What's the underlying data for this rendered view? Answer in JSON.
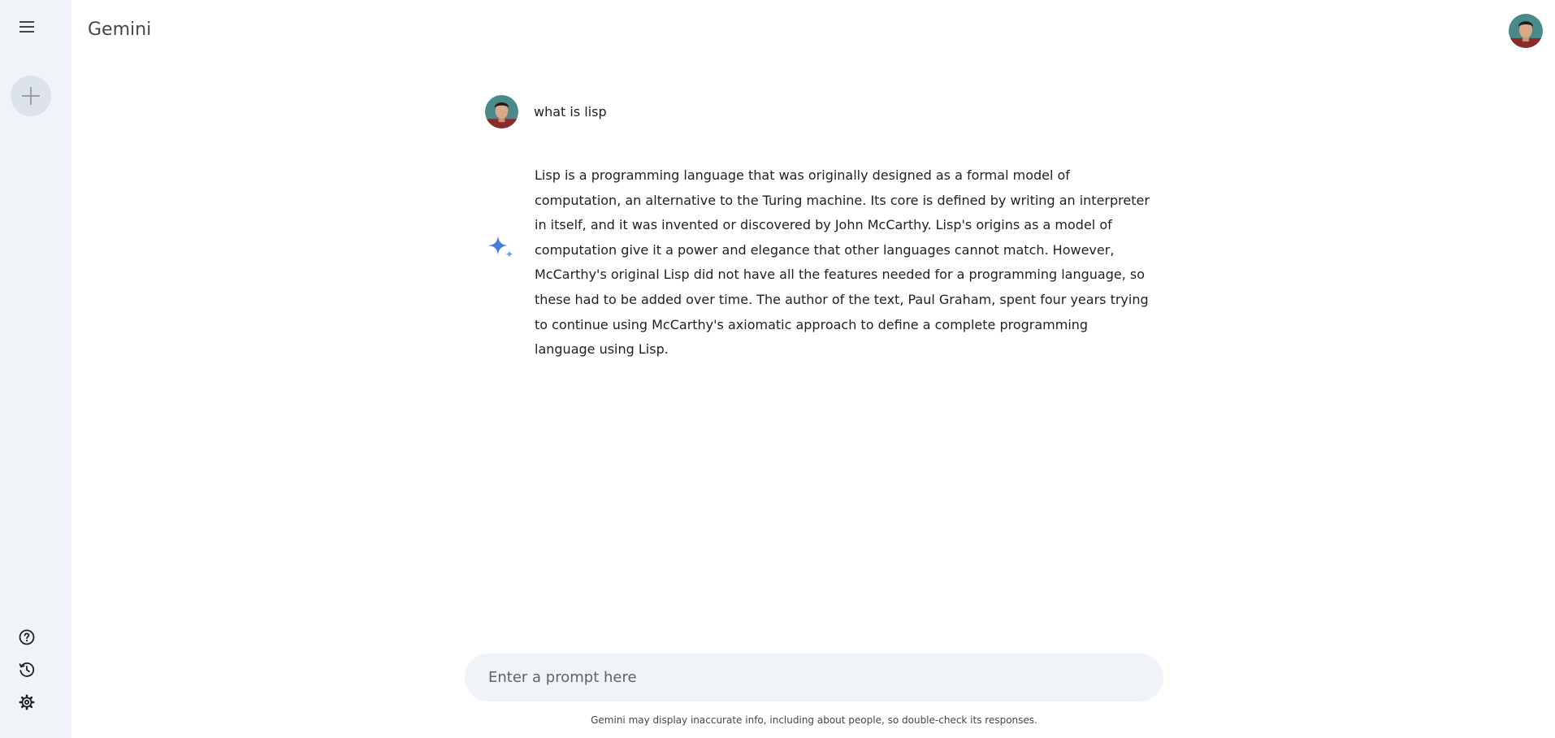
{
  "app": {
    "title": "Gemini"
  },
  "sidebar": {
    "menu_icon": "menu-icon",
    "new_chat_icon": "plus-icon",
    "bottom": [
      {
        "icon": "help-icon",
        "name": "help"
      },
      {
        "icon": "history-icon",
        "name": "activity"
      },
      {
        "icon": "gear-icon",
        "name": "settings"
      }
    ]
  },
  "conversation": {
    "user_query": "what is lisp",
    "response": "Lisp is a programming language that was originally designed as a formal model of computation, an alternative to the Turing machine. Its core is defined by writing an interpreter in itself, and it was invented or discovered by John McCarthy. Lisp's origins as a model of computation give it a power and elegance that other languages cannot match. However, McCarthy's original Lisp did not have all the features needed for a programming language, so these had to be added over time. The author of the text, Paul Graham, spent four years trying to continue using McCarthy's axiomatic approach to define a complete programming language using Lisp."
  },
  "prompt": {
    "placeholder": "Enter a prompt here",
    "value": ""
  },
  "footer": {
    "disclaimer": "Gemini may display inaccurate info, including about people, so double-check its responses."
  },
  "colors": {
    "sidebar_bg": "#f0f4f9",
    "input_bg": "#f0f4f9",
    "spark_blue": "#4a7bd6"
  }
}
